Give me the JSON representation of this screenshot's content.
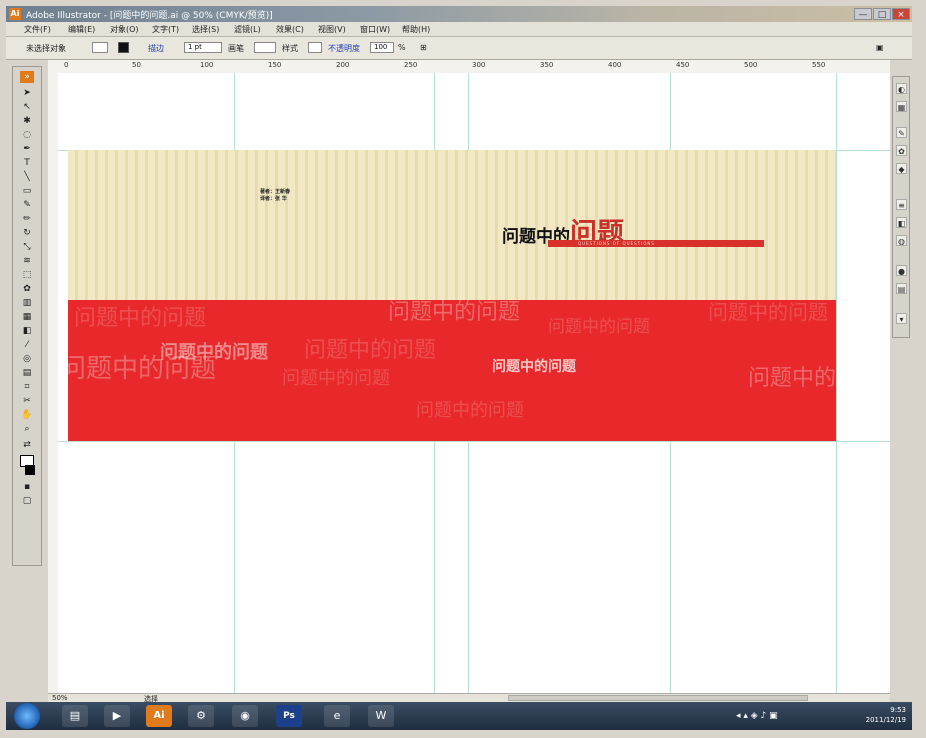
{
  "window": {
    "title": "Adobe Illustrator - [问题中的问题.ai @ 50% (CMYK/预览)]",
    "app_logo": "Ai",
    "buttons": [
      "—",
      "□",
      "×"
    ]
  },
  "menu": {
    "items": [
      "文件(F)",
      "编辑(E)",
      "对象(O)",
      "文字(T)",
      "选择(S)",
      "滤镜(L)",
      "效果(C)",
      "视图(V)",
      "窗口(W)",
      "帮助(H)"
    ]
  },
  "control": {
    "selection_label": "未选择对象",
    "stroke_label": "描边",
    "stroke_value": "1 pt",
    "brush_label": "画笔",
    "style_label": "样式",
    "opacity_label": "不透明度",
    "opacity_value": "100",
    "opacity_unit": "%"
  },
  "ruler": {
    "labels": [
      "0",
      "50",
      "100",
      "150",
      "200",
      "250",
      "300",
      "350",
      "400",
      "450",
      "500",
      "550"
    ]
  },
  "artwork": {
    "author_lines": [
      "著者：王新春",
      "译者：张 华"
    ],
    "title_black": "问题中的",
    "title_red": "问题",
    "subtitle_bar": "QUESTIONS OF QUESTIONS",
    "red_band_bold_texts": [
      "问题中的问题",
      "问题中的问题"
    ],
    "red_band_ghost_texts": [
      "问题中的问题",
      "问题中的问题",
      "问题中的问题",
      "问题中的问题",
      "问题中的问题",
      "问题中的问题",
      "问题中的问题",
      "问题中的问题",
      "问题中的问题"
    ]
  },
  "status": {
    "zoom": "50%",
    "mode": "选择"
  },
  "taskbar": {
    "apps": [
      "folder",
      "media",
      "Ai",
      "network",
      "browser",
      "Ps",
      "ie",
      "word"
    ],
    "time": "9:53",
    "date": "2011/12/19"
  },
  "colors": {
    "accent_red": "#e8282a",
    "cream": "#f2e8c4",
    "title_red": "#c8302a"
  }
}
